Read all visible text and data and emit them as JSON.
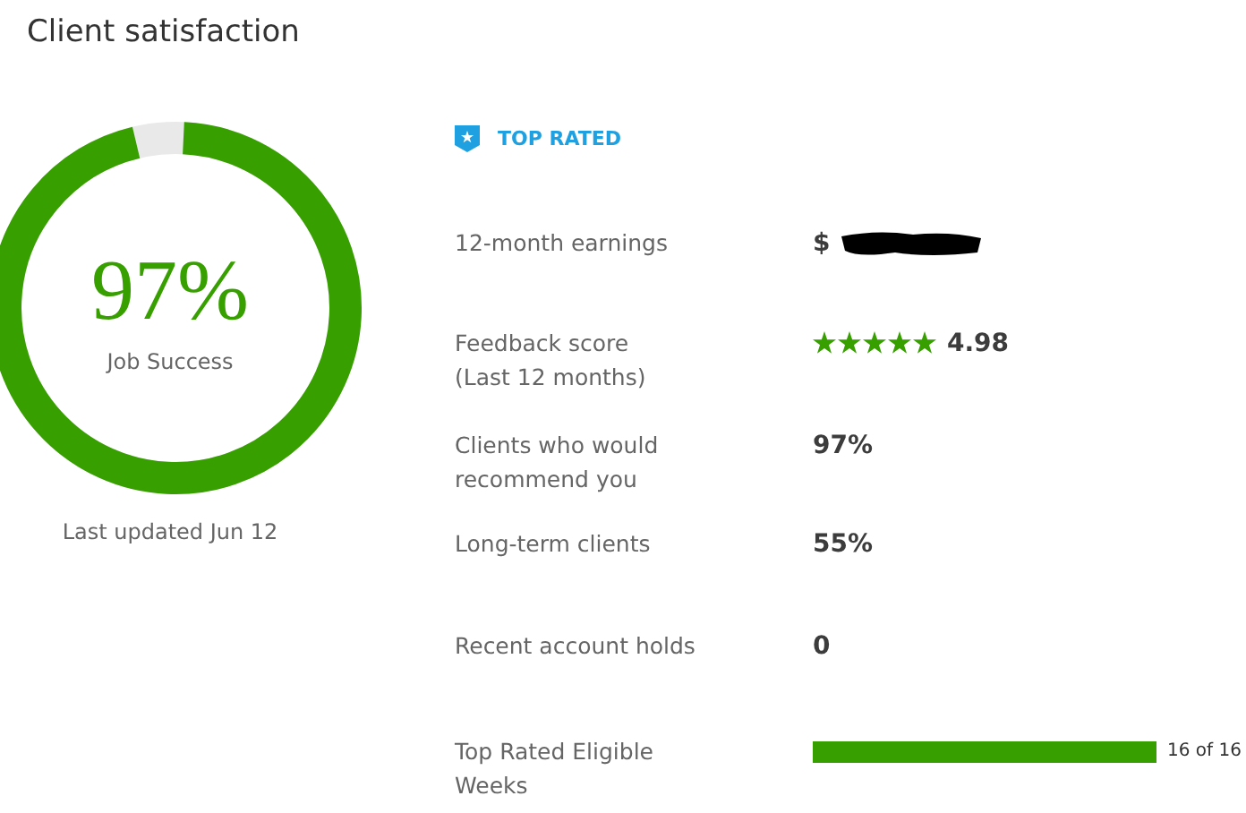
{
  "title": "Client satisfaction",
  "job_success": {
    "value": "97%",
    "label": "Job Success",
    "level": 0.97,
    "updated": "Last updated Jun 12"
  },
  "badge": {
    "label": "TOP RATED"
  },
  "metrics": [
    {
      "kind": "redacted",
      "label": "12-month earnings",
      "value": "$"
    },
    {
      "kind": "stars",
      "label": "Feedback score\n(Last 12 months)",
      "stars": 5,
      "value": "4.98"
    },
    {
      "kind": "text",
      "label": "Clients who would\nrecommend you",
      "value": "97%"
    },
    {
      "kind": "text",
      "label": "Long-term clients",
      "value": "55%"
    },
    {
      "kind": "text",
      "label": "Recent account holds",
      "value": "0"
    },
    {
      "kind": "bar",
      "label": "Top Rated Eligible\nWeeks",
      "level": 1,
      "value": "16 of 16"
    }
  ]
}
